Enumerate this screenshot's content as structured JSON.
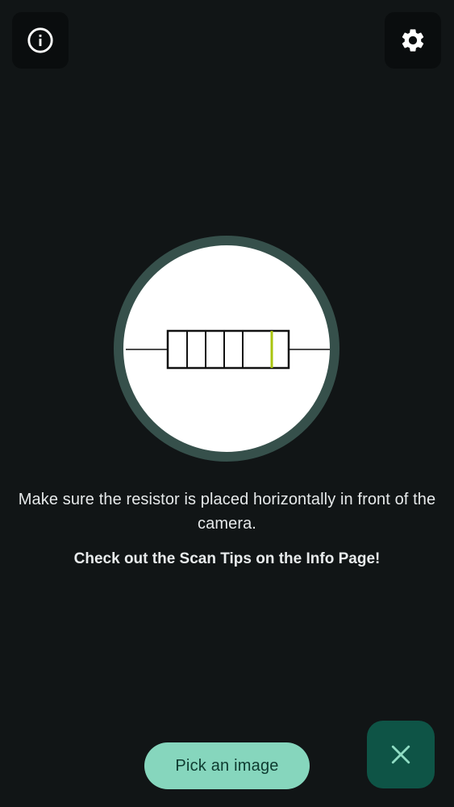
{
  "header": {
    "info_icon": "info-icon",
    "settings_icon": "gear-icon"
  },
  "illustration": {
    "icon": "resistor-icon",
    "highlight_band_color": "#a9c40f"
  },
  "messages": {
    "instruction": "Make sure the resistor is placed horizontally in front of the camera.",
    "tip": "Check out the Scan Tips on the Info Page!"
  },
  "actions": {
    "pick_label": "Pick an image",
    "close_icon": "close-icon"
  },
  "colors": {
    "background": "#111516",
    "ring": "#36504b",
    "pick_button": "#86d6bd",
    "fab": "#0e5446",
    "fab_icon": "#8fdcc3"
  }
}
